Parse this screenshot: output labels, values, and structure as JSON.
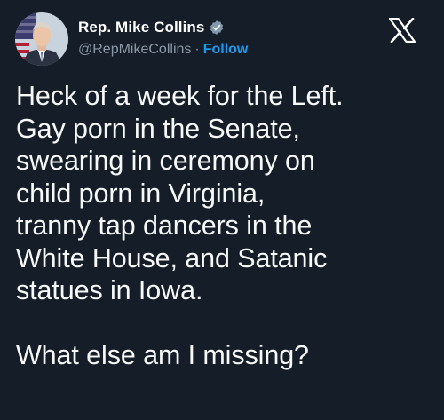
{
  "author": {
    "display_name": "Rep. Mike Collins",
    "handle": "@RepMikeCollins",
    "separator": "·",
    "follow_label": "Follow",
    "verified": true
  },
  "tweet": {
    "text": "Heck of a week for the Left.\nGay porn in the Senate,\nswearing in ceremony on\nchild porn in Virginia,\ntranny tap dancers in the\nWhite House, and Satanic\nstatues in Iowa.\n\nWhat else am I missing?"
  },
  "icons": {
    "avatar": "profile-photo",
    "verified": "verified-badge-icon",
    "platform": "x-logo-icon"
  },
  "colors": {
    "background": "#151e28",
    "text": "#f7f9f9",
    "secondary_text": "#8b98a5",
    "accent": "#1d9bf0"
  }
}
